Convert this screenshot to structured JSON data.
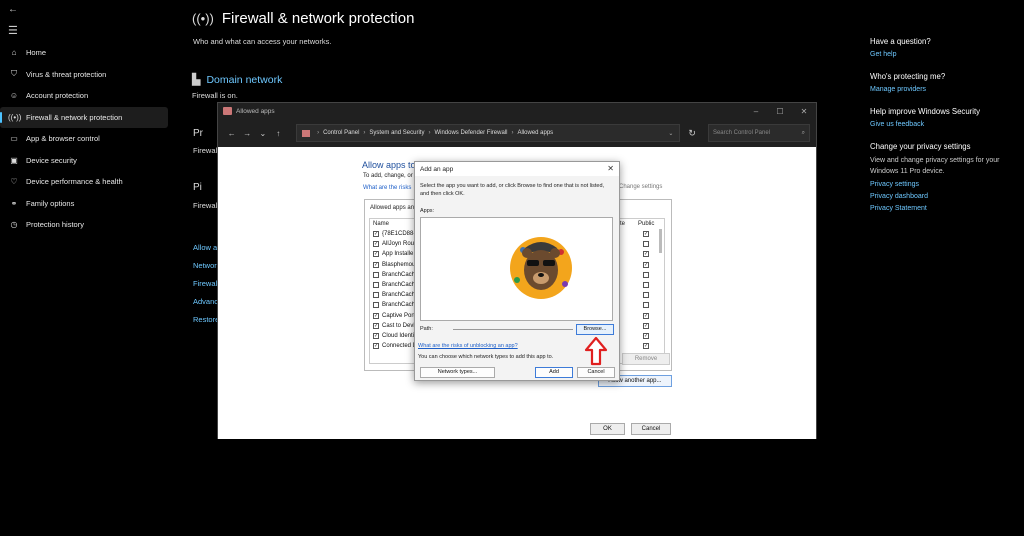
{
  "nav": {
    "items": [
      {
        "label": "Home",
        "icon": "home-icon",
        "glyph": "⌂"
      },
      {
        "label": "Virus & threat protection",
        "icon": "shield-icon",
        "glyph": "⛉"
      },
      {
        "label": "Account protection",
        "icon": "person-icon",
        "glyph": "☺"
      },
      {
        "label": "Firewall & network protection",
        "icon": "wireless-icon",
        "glyph": "((•))",
        "active": true
      },
      {
        "label": "App & browser control",
        "icon": "window-icon",
        "glyph": "▭"
      },
      {
        "label": "Device security",
        "icon": "monitor-icon",
        "glyph": "▣"
      },
      {
        "label": "Device performance & health",
        "icon": "heart-icon",
        "glyph": "♡"
      },
      {
        "label": "Family options",
        "icon": "family-icon",
        "glyph": "⚭"
      },
      {
        "label": "Protection history",
        "icon": "history-icon",
        "glyph": "◷"
      }
    ]
  },
  "main": {
    "title": "Firewall & network protection",
    "subtitle": "Who and what can access your networks.",
    "domain_title": "Domain network",
    "domain_status": "Firewall is on.",
    "private_partial": "Pr",
    "private_status_partial": "Firewal",
    "public_partial": "Pi",
    "public_status_partial": "Firewal",
    "links": [
      "Allow a",
      "Networ",
      "Firewal",
      "Advanc",
      "Restore"
    ]
  },
  "right": {
    "question": "Have a question?",
    "get_help": "Get help",
    "protecting": "Who's protecting me?",
    "manage_providers": "Manage providers",
    "improve": "Help improve Windows Security",
    "give_feedback": "Give us feedback",
    "privacy_title": "Change your privacy settings",
    "privacy_desc": "View and change privacy settings for your Windows 11 Pro device.",
    "privacy_settings": "Privacy settings",
    "privacy_dashboard": "Privacy dashboard",
    "privacy_statement": "Privacy Statement"
  },
  "allowed_window": {
    "title": "Allowed apps",
    "breadcrumb": [
      "Control Panel",
      "System and Security",
      "Windows Defender Firewall",
      "Allowed apps"
    ],
    "search_placeholder": "Search Control Panel",
    "heading": "Allow apps to",
    "sub": "To add, change, or",
    "risks_link": "What are the risks",
    "change_settings": "Change settings",
    "list_label": "Allowed apps an",
    "col_name": "Name",
    "col_private_partial": "te",
    "col_public": "Public",
    "rows": [
      {
        "name": "{78E1CD88-4",
        "checked": true,
        "public": true
      },
      {
        "name": "AllJoyn Rout",
        "checked": true,
        "public": false
      },
      {
        "name": "App Installe",
        "checked": true,
        "public": true
      },
      {
        "name": "Blasphemou",
        "checked": true,
        "public": true
      },
      {
        "name": "BranchCach",
        "checked": false,
        "public": false
      },
      {
        "name": "BranchCach",
        "checked": false,
        "public": false
      },
      {
        "name": "BranchCach",
        "checked": false,
        "public": false
      },
      {
        "name": "BranchCach",
        "checked": false,
        "public": false
      },
      {
        "name": "Captive Port",
        "checked": true,
        "public": true
      },
      {
        "name": "Cast to Devi",
        "checked": true,
        "public": true
      },
      {
        "name": "Cloud Identi",
        "checked": true,
        "public": true
      },
      {
        "name": "Connected D",
        "checked": true,
        "public": true
      }
    ],
    "remove": "Remove",
    "allow_another": "Allow another app...",
    "ok": "OK",
    "cancel": "Cancel"
  },
  "add_dialog": {
    "title": "Add an app",
    "desc": "Select the app you want to add, or click Browse to find one that is not listed, and then click OK.",
    "apps_label": "Apps:",
    "path_label": "Path:",
    "browse": "Browse...",
    "risks": "What are the risks of unblocking an app?",
    "note": "You can choose which network types to add this app to.",
    "network_types": "Network types...",
    "add": "Add",
    "cancel": "Cancel"
  },
  "colors": {
    "accent": "#4cc2ff",
    "link": "#6ec8ff",
    "arrow": "#e02020"
  }
}
